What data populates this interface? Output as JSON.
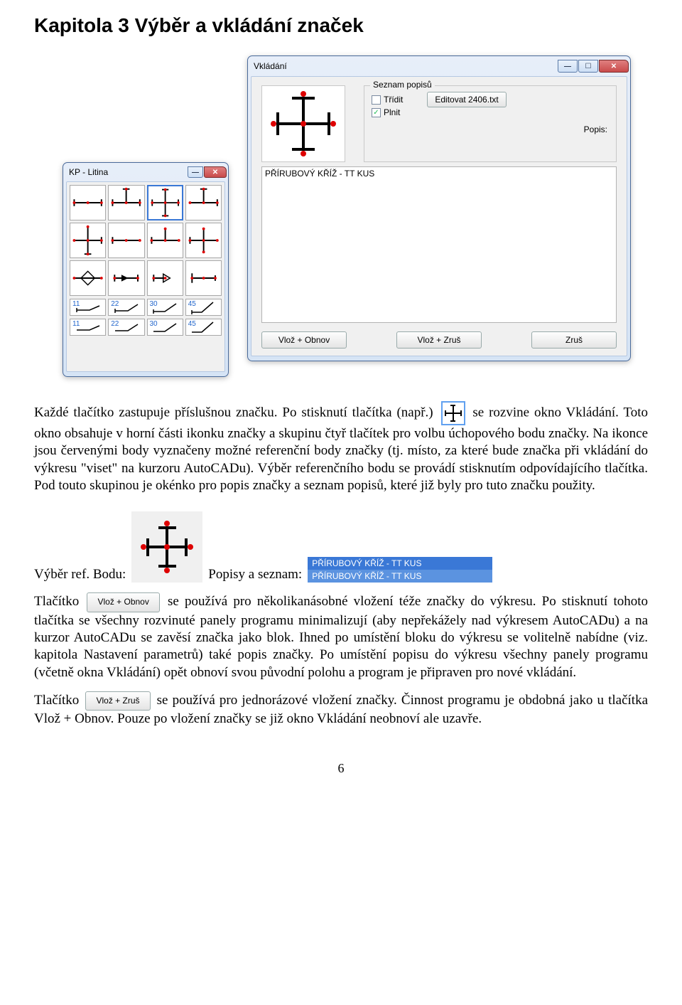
{
  "chapter_title": "Kapitola 3  Výběr a vkládání značek",
  "vkladani_window": {
    "title": "Vkládání",
    "seznam_legend": "Seznam popisů",
    "chk_tridit": "Třídit",
    "chk_plnit": "Plnit",
    "edit_btn": "Editovat 2406.txt",
    "popis_label": "Popis:",
    "list_first_item": "PŘÍRUBOVÝ KŘÍŽ - TT KUS",
    "btn_vloz_obnov": "Vlož + Obnov",
    "btn_vloz_zrus": "Vlož + Zruš",
    "btn_zrus": "Zruš"
  },
  "kp_window": {
    "title": "KP - Litina",
    "deg_labels": [
      "11",
      "22",
      "30",
      "45"
    ]
  },
  "para1_a": "Každé tlačítko zastupuje příslušnou značku. Po stisknutí tlačítka (např.)",
  "para1_b": "se rozvine okno Vkládání. Toto okno obsahuje v horní části ikonku značky a skupinu čtyř tlačítek pro volbu úchopového bodu značky. Na ikonce jsou červenými body vyznačeny možné referenční body značky (tj. místo, za které bude značka při vkládání do výkresu \"viset\" na kurzoru AutoCADu). Výběr referenčního bodu se provádí stisknutím odpovídajícího tlačítka. Pod touto skupinou je okénko pro popis značky a seznam popisů, které již byly pro tuto značku použity.",
  "row2_label_a": "Výběr ref. Bodu:",
  "row2_label_b": "Popisy a seznam:",
  "popis_demo_items": [
    "PŘÍRUBOVÝ KŘÍŽ - TT KUS",
    "PŘÍRUBOVÝ KŘÍŽ - TT KUS"
  ],
  "para2_a": "Tlačítko",
  "para2_b": "se používá pro několikanásobné vložení téže značky do výkresu. Po stisknutí tohoto tlačítka se všechny rozvinuté panely programu minimalizují (aby nepřekážely nad výkresem AutoCADu) a na kurzor AutoCADu se zavěsí značka jako blok. Ihned po umístění bloku do výkresu se volitelně nabídne (viz. kapitola Nastavení parametrů) také popis značky. Po umístění popisu do výkresu všechny panely programu (včetně okna Vkládání) opět obnoví svou původní polohu a program je připraven pro nové vkládání.",
  "para3_a": "Tlačítko",
  "para3_b": "se používá pro jednorázové vložení značky. Činnost programu je obdobná jako u tlačítka Vlož + Obnov. Pouze po vložení značky se již okno Vkládání neobnoví ale uzavře.",
  "btn_inline_vloz_obnov": "Vlož + Obnov",
  "btn_inline_vloz_zrus": "Vlož + Zruš",
  "page_number": "6"
}
